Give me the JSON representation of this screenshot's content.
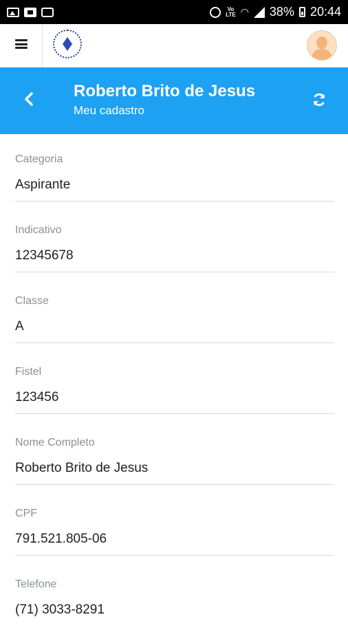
{
  "status_bar": {
    "battery": "38%",
    "time": "20:44",
    "volte": "VoLTE",
    "icons": [
      "image-icon",
      "gallery-icon",
      "calendar-icon",
      "alarm-icon",
      "volte-icon",
      "wifi-icon",
      "signal-icon",
      "battery-icon"
    ]
  },
  "navbar": {
    "menu_icon": "hamburger-menu-icon",
    "logo_icon": "club-logo-icon",
    "avatar_icon": "user-avatar-icon"
  },
  "header": {
    "title": "Roberto Brito de Jesus",
    "subtitle": "Meu cadastro",
    "back_icon": "chevron-left-icon",
    "refresh_icon": "refresh-icon",
    "background_color": "#1da1f2"
  },
  "fields": [
    {
      "label": "Categoria",
      "value": "Aspirante"
    },
    {
      "label": "Indicativo",
      "value": "12345678"
    },
    {
      "label": "Classe",
      "value": "A"
    },
    {
      "label": "Fistel",
      "value": "123456"
    },
    {
      "label": "Nome Completo",
      "value": "Roberto Brito de Jesus"
    },
    {
      "label": "CPF",
      "value": "791.521.805-06"
    },
    {
      "label": "Telefone",
      "value": "(71) 3033-8291"
    }
  ]
}
